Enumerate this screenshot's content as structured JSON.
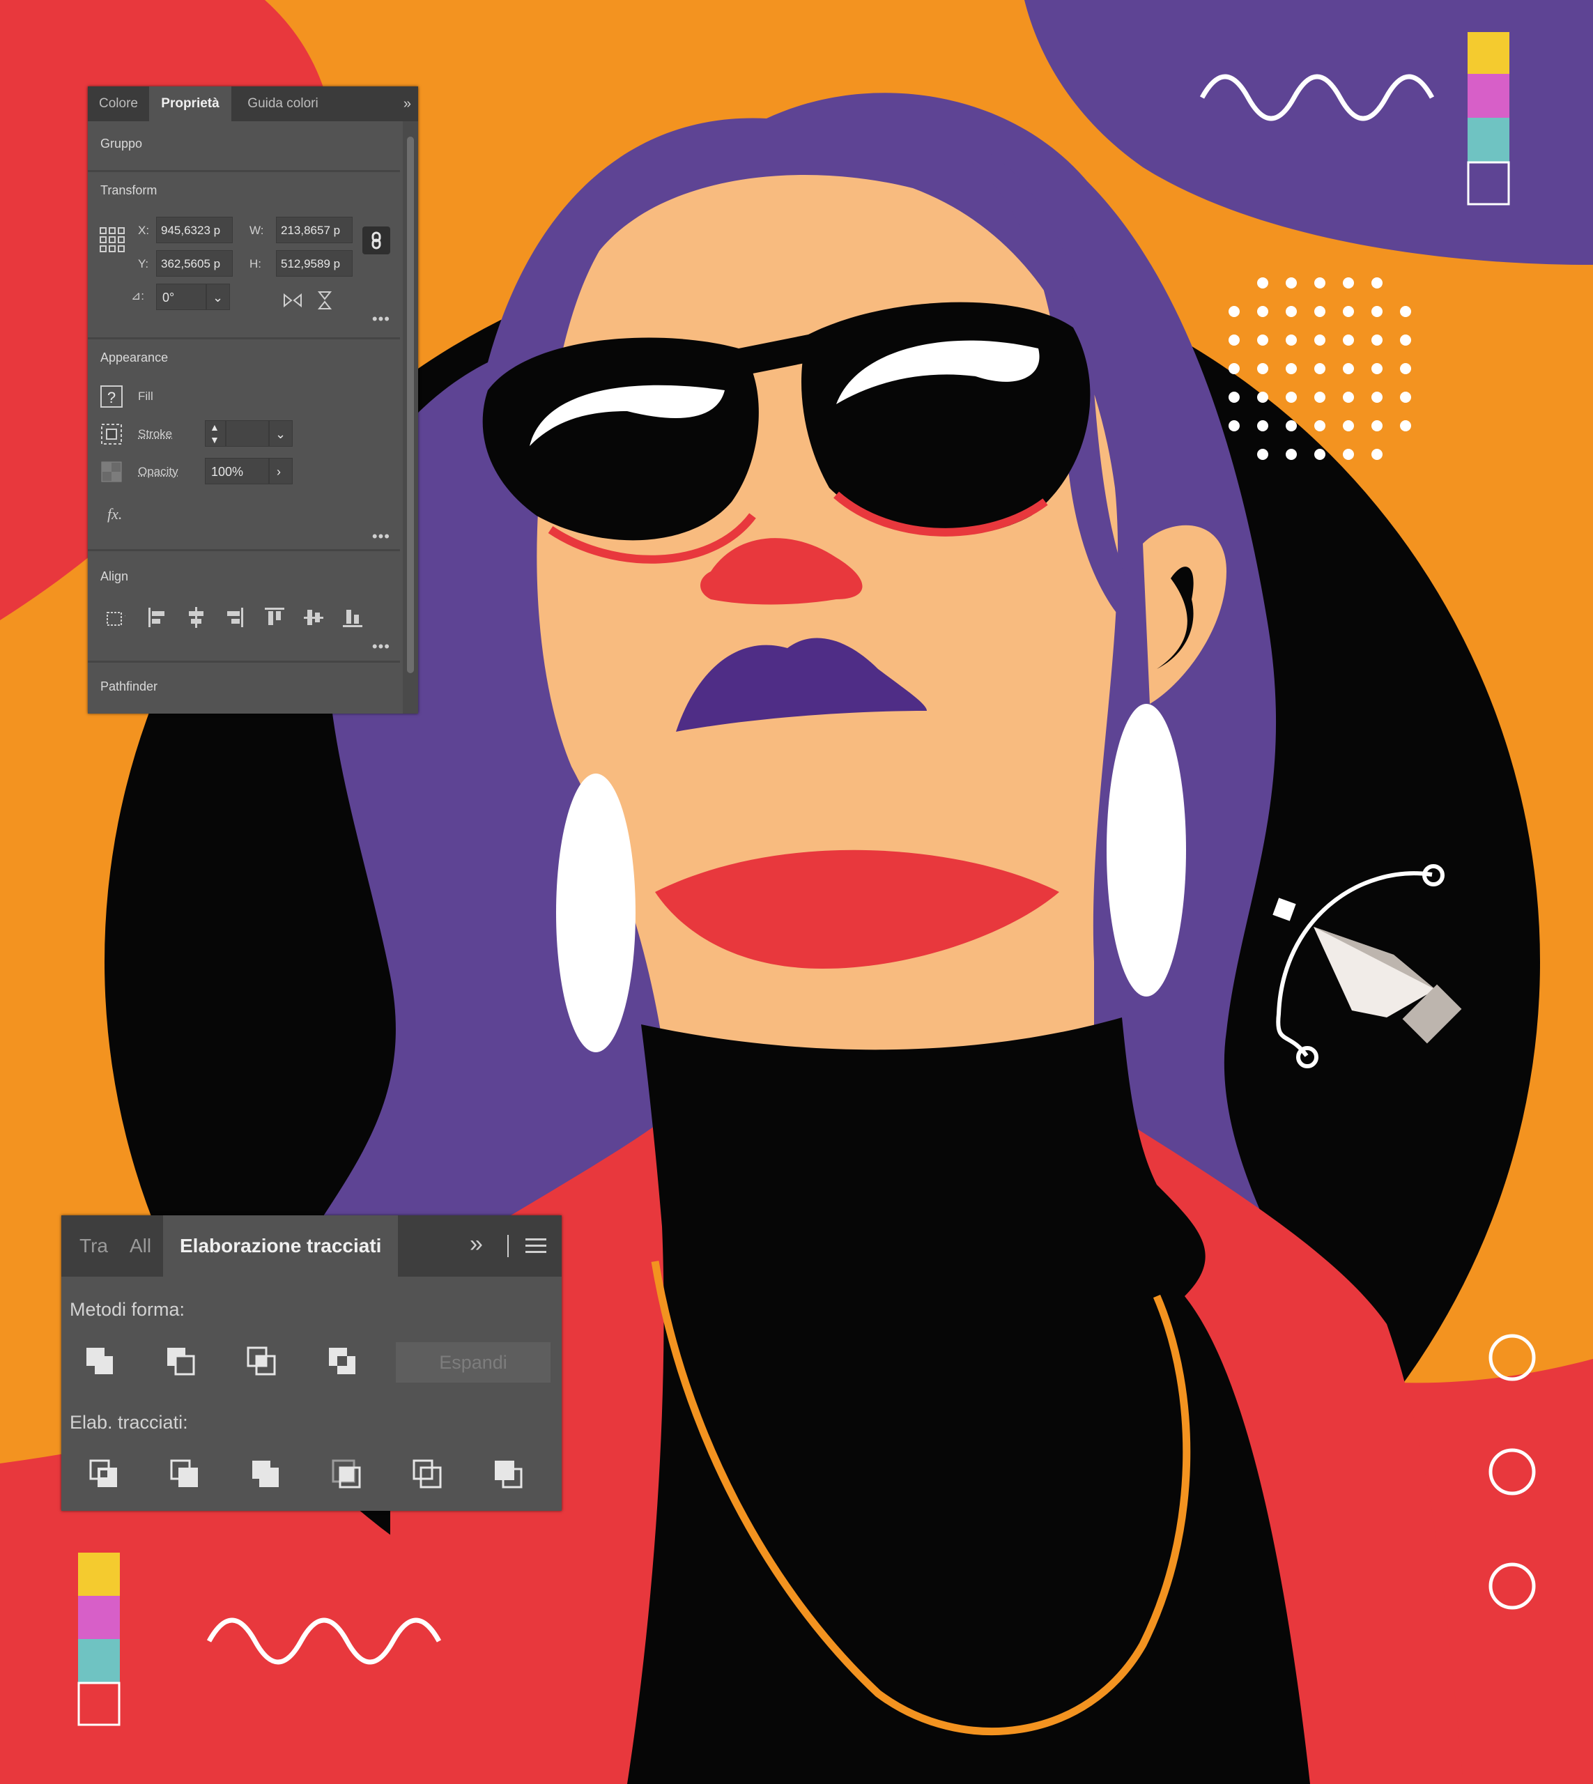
{
  "properties_panel": {
    "tabs": [
      {
        "label": "Colore",
        "active": false
      },
      {
        "label": "Proprietà",
        "active": true
      },
      {
        "label": "Guida colori",
        "active": false
      }
    ],
    "collapse_icon": "double-chevron-right-icon",
    "object_type": "Gruppo",
    "transform": {
      "title": "Transform",
      "x_label": "X:",
      "x_value": "945,6323 p",
      "y_label": "Y:",
      "y_value": "362,5605 p",
      "w_label": "W:",
      "w_value": "213,8657 p",
      "h_label": "H:",
      "h_value": "512,9589 p",
      "angle_label": "⊿:",
      "angle_value": "0°"
    },
    "appearance": {
      "title": "Appearance",
      "fill_label": "Fill",
      "stroke_label": "Stroke",
      "opacity_label": "Opacity",
      "opacity_value": "100%",
      "fx_label": "fx."
    },
    "align": {
      "title": "Align"
    },
    "pathfinder": {
      "title": "Pathfinder"
    },
    "more_label": "•••"
  },
  "pathfinder_panel": {
    "tabs": [
      {
        "label": "Tra",
        "active": false
      },
      {
        "label": "All",
        "active": false
      },
      {
        "label": "Elaborazione tracciati",
        "active": true
      }
    ],
    "collapse_icon": "double-chevron-right-icon",
    "menu_icon": "hamburger-menu-icon",
    "shape_modes_label": "Metodi forma:",
    "expand_label": "Espandi",
    "pathfinders_label": "Elab. tracciati:"
  },
  "colors": {
    "orange": "#f39320",
    "red": "#e8383d",
    "purple": "#5e4494",
    "skin": "#f8bb7f",
    "black": "#060606",
    "white": "#ffffff",
    "lips": "#4f2d86",
    "swatch_yellow": "#f4cb2f",
    "swatch_magenta": "#d75fc8",
    "swatch_teal": "#6fc3c2",
    "panel_bg": "#535353"
  }
}
